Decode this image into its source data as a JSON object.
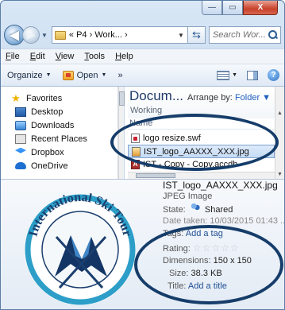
{
  "window": {
    "controls": [
      "—",
      "▭",
      "X"
    ]
  },
  "nav": {
    "back": "◀",
    "forward": "▶",
    "address_text": "« P4 › Work... ›",
    "search_placeholder": "Search Wor..."
  },
  "menu": {
    "items": [
      {
        "u": "F",
        "rest": "ile"
      },
      {
        "u": "E",
        "rest": "dit"
      },
      {
        "u": "V",
        "rest": "iew"
      },
      {
        "u": "T",
        "rest": "ools"
      },
      {
        "u": "H",
        "rest": "elp"
      }
    ]
  },
  "toolbar": {
    "organize": "Organize",
    "open": "Open",
    "more": "»"
  },
  "sidebar": {
    "items": [
      {
        "label": "Favorites",
        "icon": "star-icon"
      },
      {
        "label": "Desktop",
        "icon": "desktop-icon"
      },
      {
        "label": "Downloads",
        "icon": "downloads-icon"
      },
      {
        "label": "Recent Places",
        "icon": "recent-places-icon"
      },
      {
        "label": "Dropbox",
        "icon": "dropbox-icon"
      },
      {
        "label": "OneDrive",
        "icon": "onedrive-icon"
      }
    ]
  },
  "library": {
    "title": "Docum...",
    "subtitle": "Working",
    "arrange_label": "Arrange by:",
    "arrange_value": "Folder",
    "column_name": "Name"
  },
  "files": [
    {
      "name": "logo resize.swf",
      "icon": "swf-file-icon",
      "selected": false
    },
    {
      "name": "IST_logo_AAXXX_XXX.jpg",
      "icon": "jpg-file-icon",
      "selected": true
    },
    {
      "name": "IST - Copy - Copy.accdb",
      "icon": "access-file-icon",
      "selected": false
    }
  ],
  "details": {
    "filename": "IST_logo_AAXXX_XXX.jpg",
    "type": "JPEG Image",
    "state_label": "State:",
    "state_value": "Shared",
    "date_label": "Date taken:",
    "date_value": "10/03/2015 01:43 ...",
    "tags_label": "Tags:",
    "tags_value": "Add a tag",
    "rating_label": "Rating:",
    "rating_stars": "☆☆☆☆☆",
    "dimensions_label": "Dimensions:",
    "dimensions_value": "150 x 150",
    "size_label": "Size:",
    "size_value": "38.3 KB",
    "title_label": "Title:",
    "title_value": "Add a title"
  },
  "logo": {
    "text": "International Ski Tour",
    "colors": {
      "ring": "#2c9ec8",
      "letters": "#1b3f6e",
      "mountain_dark": "#133565",
      "mountain_light": "#3f86c6"
    }
  },
  "colors": {
    "highlight_ellipse": "#163d6a",
    "selection": "#c5dcf5"
  }
}
